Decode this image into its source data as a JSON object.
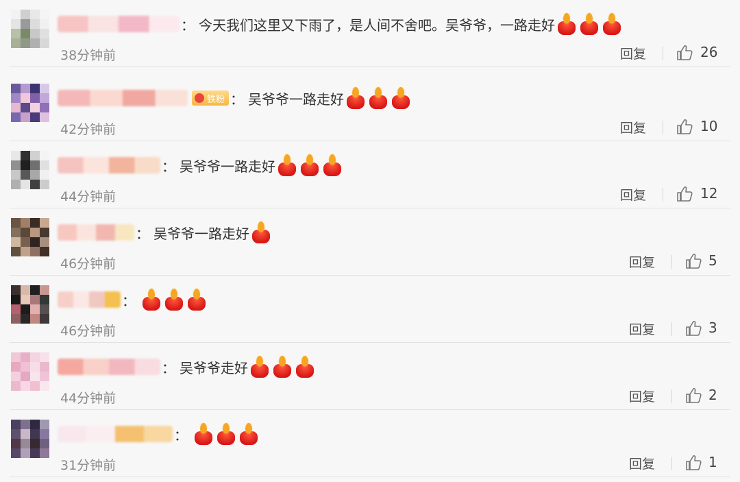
{
  "ui": {
    "reply_label": "回复",
    "colon": "："
  },
  "comments": [
    {
      "text": "今天我们这里又下雨了，是人间不舍吧。吴爷爷，一路走好",
      "candles": 3,
      "time": "38分钟前",
      "likes": "26",
      "badge": null,
      "avatar_colors": [
        "#f2f2f2",
        "#cfcfcf",
        "#e8e8e8",
        "#f4f4f4",
        "#e4e4e4",
        "#9a9a9a",
        "#dcdcdc",
        "#f0f0f0",
        "#b8c0a8",
        "#7a8a68",
        "#c8c8c8",
        "#e0e0e0",
        "#a8b098",
        "#909888",
        "#b0b0b0",
        "#d8d8d8"
      ],
      "name_colors": [
        "#f7c3c3",
        "#f9e3e3",
        "#f3b8c8",
        "#fbe9ee"
      ]
    },
    {
      "text": "吴爷爷一路走好",
      "candles": 3,
      "time": "42分钟前",
      "likes": "10",
      "badge": "铁粉",
      "avatar_colors": [
        "#6a5a9a",
        "#b49ad0",
        "#3c3470",
        "#d8c8e8",
        "#a088c8",
        "#f0c8d8",
        "#8060a8",
        "#c0a8d8",
        "#e8b8d0",
        "#5a4a8a",
        "#f4d0e0",
        "#9070b8",
        "#7868b0",
        "#c8a0c8",
        "#4a3a7a",
        "#e0c0e0"
      ],
      "name_colors": [
        "#f4b8b8",
        "#fbd8d0",
        "#f0a8a0",
        "#f9e0d8"
      ]
    },
    {
      "text": "吴爷爷一路走好",
      "candles": 3,
      "time": "44分钟前",
      "likes": "12",
      "badge": null,
      "avatar_colors": [
        "#e8e8e8",
        "#303030",
        "#d0d0d0",
        "#f4f4f4",
        "#909090",
        "#202020",
        "#707070",
        "#e0e0e0",
        "#c8c8c8",
        "#585858",
        "#a8a8a8",
        "#f0f0f0",
        "#b0b0b0",
        "#e4e4e4",
        "#404040",
        "#cccccc"
      ],
      "name_colors": [
        "#f6c4c0",
        "#fbe4dc",
        "#f2b49c",
        "#f8dcc8"
      ]
    },
    {
      "text": "吴爷爷一路走好",
      "candles": 1,
      "time": "46分钟前",
      "likes": "5",
      "badge": null,
      "avatar_colors": [
        "#6a5444",
        "#a08068",
        "#3a2c24",
        "#c8a890",
        "#84705c",
        "#5c4838",
        "#b89880",
        "#483830",
        "#d0b8a0",
        "#786050",
        "#302420",
        "#a89080",
        "#605040",
        "#c0a088",
        "#907060",
        "#403028"
      ],
      "name_colors": [
        "#f6c8c0",
        "#fbe4de",
        "#f2b8b0",
        "#f8e6c0"
      ]
    },
    {
      "text": "",
      "candles": 3,
      "time": "46分钟前",
      "likes": "3",
      "badge": null,
      "avatar_colors": [
        "#3a3030",
        "#d8b8a8",
        "#202020",
        "#c89890",
        "#181818",
        "#e8c8b8",
        "#a87878",
        "#303838",
        "#b86070",
        "#1c1c1c",
        "#e0b0b0",
        "#585050",
        "#906060",
        "#282828",
        "#c08880",
        "#403838"
      ],
      "name_colors": [
        "#f6d0c8",
        "#fbe8e4",
        "#f0c8c0",
        "#f4c050"
      ]
    },
    {
      "text": "吴爷爷走好",
      "candles": 3,
      "time": "44分钟前",
      "likes": "2",
      "badge": null,
      "avatar_colors": [
        "#f0c8d8",
        "#e8b0c8",
        "#f4d4e0",
        "#f8e0e8",
        "#e8a8c0",
        "#f0c0d4",
        "#f8dce6",
        "#eab8cc",
        "#f4d0de",
        "#e4a8c0",
        "#f8e4ec",
        "#f0c4d6",
        "#ecb8ce",
        "#f6d8e4",
        "#f0c0d0",
        "#f8e8ee"
      ],
      "name_colors": [
        "#f4a8a0",
        "#f8d0c8",
        "#f2b8c0",
        "#f8dce0"
      ]
    },
    {
      "text": "",
      "candles": 3,
      "time": "31分钟前",
      "likes": "1",
      "badge": null,
      "avatar_colors": [
        "#4a4060",
        "#807090",
        "#302840",
        "#a098b0",
        "#605070",
        "#c8b8c8",
        "#403850",
        "#8878a0",
        "#503848",
        "#988898",
        "#382830",
        "#706080",
        "#584868",
        "#b0a0b8",
        "#483858",
        "#907898"
      ],
      "name_colors": [
        "#f8e8ee",
        "#fbeef0",
        "#f4c070",
        "#f8d8a0"
      ]
    }
  ]
}
